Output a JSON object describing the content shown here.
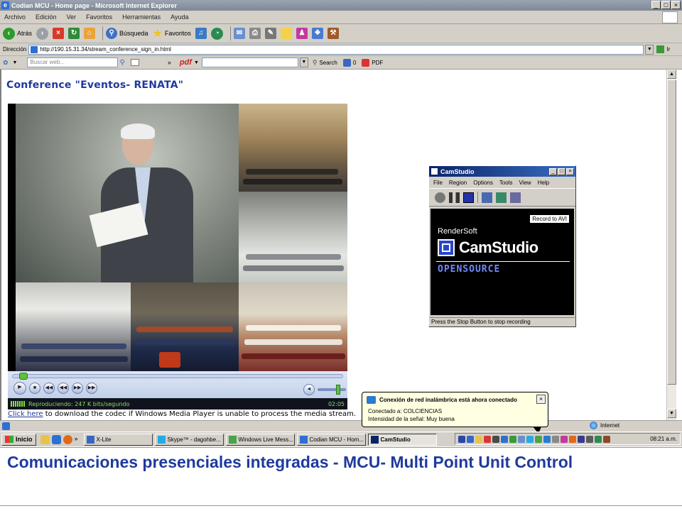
{
  "window": {
    "title": "Codian MCU - Home page - Microsoft Internet Explorer",
    "min": "_",
    "max": "□",
    "close": "×"
  },
  "menu": [
    "Archivo",
    "Edición",
    "Ver",
    "Favoritos",
    "Herramientas",
    "Ayuda"
  ],
  "toolbar": {
    "back": "Atrás",
    "search": "Búsqueda",
    "favorites": "Favoritos"
  },
  "address": {
    "label": "Dirección",
    "url": "http://190.15.31.34/stream_conference_sign_in.html",
    "go": "Ir"
  },
  "searchbar": {
    "placeholder": "Buscar web...",
    "pdf_logo": "pdf",
    "search": "Search",
    "count": "0",
    "pdf": "PDF"
  },
  "page": {
    "conference_title": "Conference \"Eventos- RENATA\"",
    "codec_link": "Click here",
    "codec_text": " to download the codec if Windows Media Player is unable to process the media stream."
  },
  "player": {
    "status": "Reproduciendo: 247 K bits/segundo",
    "time": "02:05",
    "progress": 0.02
  },
  "camstudio": {
    "title": "CamStudio",
    "menu": [
      "File",
      "Region",
      "Options",
      "Tools",
      "View",
      "Help"
    ],
    "record_tooltip": "Record to AVI",
    "brand_small": "RenderSoft",
    "brand_name": "CamStudio",
    "brand_os": "OPENSOURCE",
    "status": "Press the Stop Button to stop recording"
  },
  "balloon": {
    "title": "Conexión de red inalámbrica está ahora conectado",
    "line1": "Conectado a: COLCIENCIAS",
    "line2": "Intensidad de la señal: Muy buena",
    "close": "×"
  },
  "iestatus": {
    "zone": "Internet"
  },
  "taskbar": {
    "start": "Inicio",
    "tasks": [
      {
        "label": "X-Lite",
        "color": "#3a66c4"
      },
      {
        "label": "Skype™ - dagohbe...",
        "color": "#27a9e1"
      },
      {
        "label": "Windows Live Mess...",
        "color": "#4aa24a"
      },
      {
        "label": "Codian MCU - Hom...",
        "color": "#2f6fd1"
      },
      {
        "label": "CamStudio",
        "color": "#0a246a"
      }
    ],
    "clock": "08:21 a.m."
  },
  "caption": "Comunicaciones presenciales integradas - MCU- Multi Point Unit Control",
  "colors": {
    "accent_blue": "#1f3a9e",
    "titlebar": "#0a246a",
    "balloon_bg": "#ffffe1"
  }
}
